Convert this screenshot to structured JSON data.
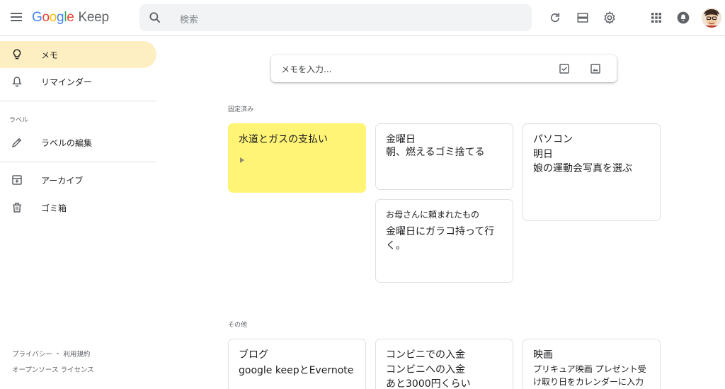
{
  "header": {
    "logo_google": [
      "G",
      "o",
      "o",
      "g",
      "l",
      "e"
    ],
    "logo_keep": "Keep",
    "search_placeholder": "検索"
  },
  "sidebar": {
    "items": [
      {
        "label": "メモ",
        "icon": "lightbulb-icon",
        "active": true
      },
      {
        "label": "リマインダー",
        "icon": "bell-icon"
      },
      {
        "label": "ラベルの編集",
        "icon": "pencil-icon"
      },
      {
        "label": "アーカイブ",
        "icon": "archive-icon"
      },
      {
        "label": "ゴミ箱",
        "icon": "trash-icon"
      }
    ],
    "section_label": "ラベル",
    "footer": {
      "line1": "プライバシー ・ 利用規約",
      "line2": "オープンソース ライセンス"
    }
  },
  "take_note": {
    "placeholder": "メモを入力..."
  },
  "pinned": {
    "label": "固定済み",
    "notes": [
      {
        "title": "水道とガスの支払い",
        "body": "",
        "color": "#fff475"
      },
      {
        "title": "金曜日",
        "body": "朝、燃えるゴミ捨てる"
      },
      {
        "title": "お母さんに頼まれたもの",
        "body": "金曜日にガラコ持って行く。"
      },
      {
        "title": "パソコン",
        "body": "明日\n娘の運動会写真を選ぶ"
      }
    ]
  },
  "others": {
    "label": "その他",
    "notes": [
      {
        "title": "ブログ",
        "body": "google keepとEvernote"
      },
      {
        "title": "コンビニでの入金",
        "body": "コンビニへの入金\nあと3000円くらい"
      },
      {
        "title": "映画",
        "body": "プリキュア映画 プレゼント受け取り日をカレンダーに入力"
      }
    ]
  },
  "colors": {
    "active_nav": "#feefc3",
    "yellow_note": "#fff475"
  }
}
